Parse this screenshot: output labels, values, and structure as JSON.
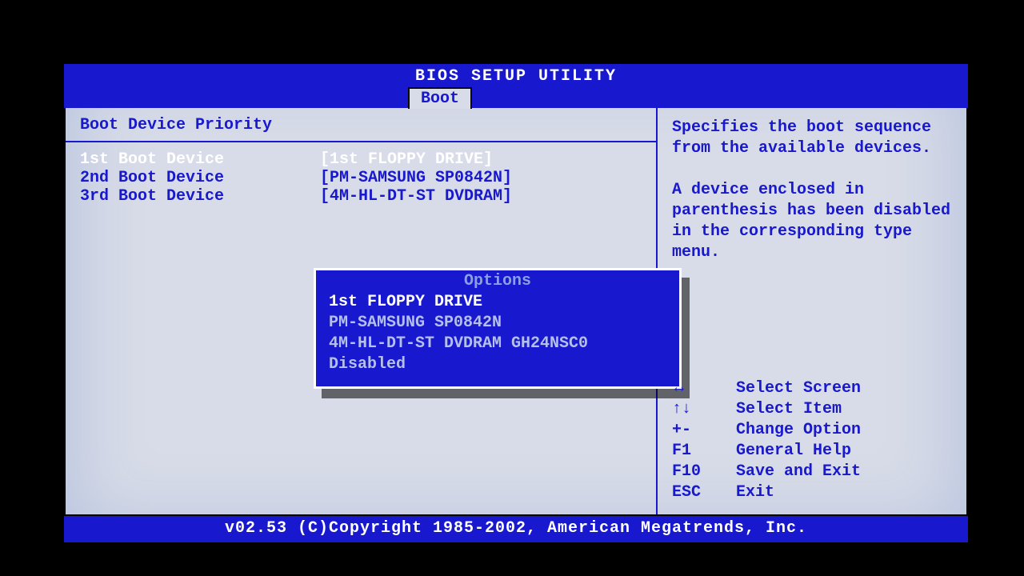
{
  "title": "BIOS SETUP UTILITY",
  "active_tab": "Boot",
  "section_title": "Boot Device Priority",
  "boot_devices": [
    {
      "label": "1st Boot Device",
      "value": "[1st FLOPPY DRIVE]",
      "selected": true
    },
    {
      "label": "2nd Boot Device",
      "value": "[PM-SAMSUNG SP0842N]",
      "selected": false
    },
    {
      "label": "3rd Boot Device",
      "value": "[4M-HL-DT-ST DVDRAM]",
      "selected": false
    }
  ],
  "popup": {
    "title": "Options",
    "items": [
      {
        "text": "1st FLOPPY DRIVE",
        "selected": true
      },
      {
        "text": "PM-SAMSUNG SP0842N",
        "selected": false
      },
      {
        "text": "4M-HL-DT-ST DVDRAM GH24NSC0",
        "selected": false
      },
      {
        "text": "Disabled",
        "selected": false
      }
    ]
  },
  "help": {
    "description": "Specifies the boot sequence from the available devices.\n\nA device enclosed in parenthesis has been disabled in the corresponding type menu.",
    "keys": [
      {
        "key_icon": "↔",
        "key": "",
        "action": "Select Screen"
      },
      {
        "key_icon": "↑↓",
        "key": "",
        "action": "Select Item"
      },
      {
        "key_icon": "",
        "key": "+-",
        "action": "Change Option"
      },
      {
        "key_icon": "",
        "key": "F1",
        "action": "General Help"
      },
      {
        "key_icon": "",
        "key": "F10",
        "action": "Save and Exit"
      },
      {
        "key_icon": "",
        "key": "ESC",
        "action": "Exit"
      }
    ]
  },
  "footer": "v02.53 (C)Copyright 1985-2002, American Megatrends, Inc."
}
